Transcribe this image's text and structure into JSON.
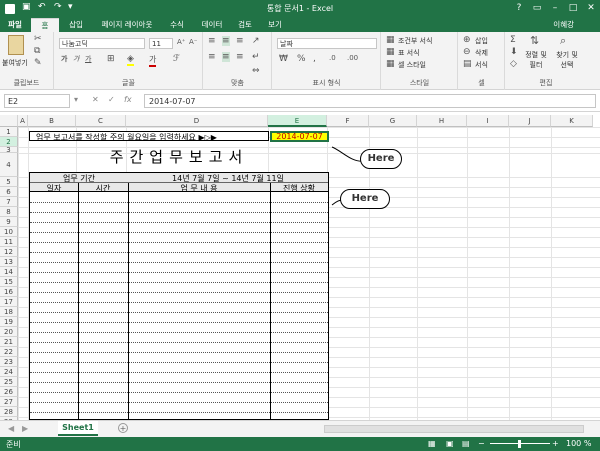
{
  "window": {
    "title": "통합 문서1 - Excel",
    "user": "이혜강"
  },
  "ribbon_tabs": [
    "파일",
    "홈",
    "삽입",
    "페이지 레이아웃",
    "수식",
    "데이터",
    "검토",
    "보기"
  ],
  "ribbon": {
    "clipboard": {
      "paste": "붙여넣기",
      "label": "클립보드"
    },
    "font": {
      "name": "나눔고딕",
      "size": "11",
      "label": "글꼴",
      "bold": "가",
      "italic": "가",
      "underline": "가"
    },
    "align": {
      "label": "맞춤"
    },
    "number": {
      "format": "날짜",
      "label": "표시 형식"
    },
    "styles": {
      "conditional": "조건부 서식",
      "table": "표 서식",
      "cell": "셀 스타일",
      "label": "스타일"
    },
    "cells": {
      "insert": "삽입",
      "delete": "삭제",
      "format": "서식",
      "label": "셀"
    },
    "editing": {
      "sort": "정렬 및 필터",
      "find": "찾기 및 선택",
      "label": "편집"
    }
  },
  "formula_bar": {
    "name_box": "E2",
    "cancel": "✕",
    "enter": "✓",
    "fx": "fx",
    "value": "2014-07-07"
  },
  "columns": [
    "A",
    "B",
    "C",
    "D",
    "E",
    "F",
    "G",
    "H",
    "I",
    "J",
    "K"
  ],
  "rows": [
    "1",
    "2",
    "3",
    "4",
    "5",
    "6",
    "7",
    "8",
    "9",
    "10",
    "11",
    "12",
    "13",
    "14",
    "15",
    "16",
    "17",
    "18",
    "19",
    "20",
    "21",
    "22",
    "23",
    "24",
    "25",
    "26",
    "27",
    "28",
    "29"
  ],
  "sheet": {
    "prompt": "업무 보고서를 작성할 주의 월요일을 입력하세요  ▶▷▶",
    "date": "2014-07-07",
    "title": "주간업무보고서",
    "period_label": "업무 기간",
    "period_value": "14년 7월 7일 ~ 14년 7월 11일",
    "headers": [
      "일자",
      "시간",
      "업 무 내 용",
      "진행 상황"
    ],
    "callout1": "Here",
    "callout2": "Here"
  },
  "sheet_tabs": [
    "Sheet1"
  ],
  "status": {
    "ready": "준비",
    "zoom": "100 %"
  }
}
